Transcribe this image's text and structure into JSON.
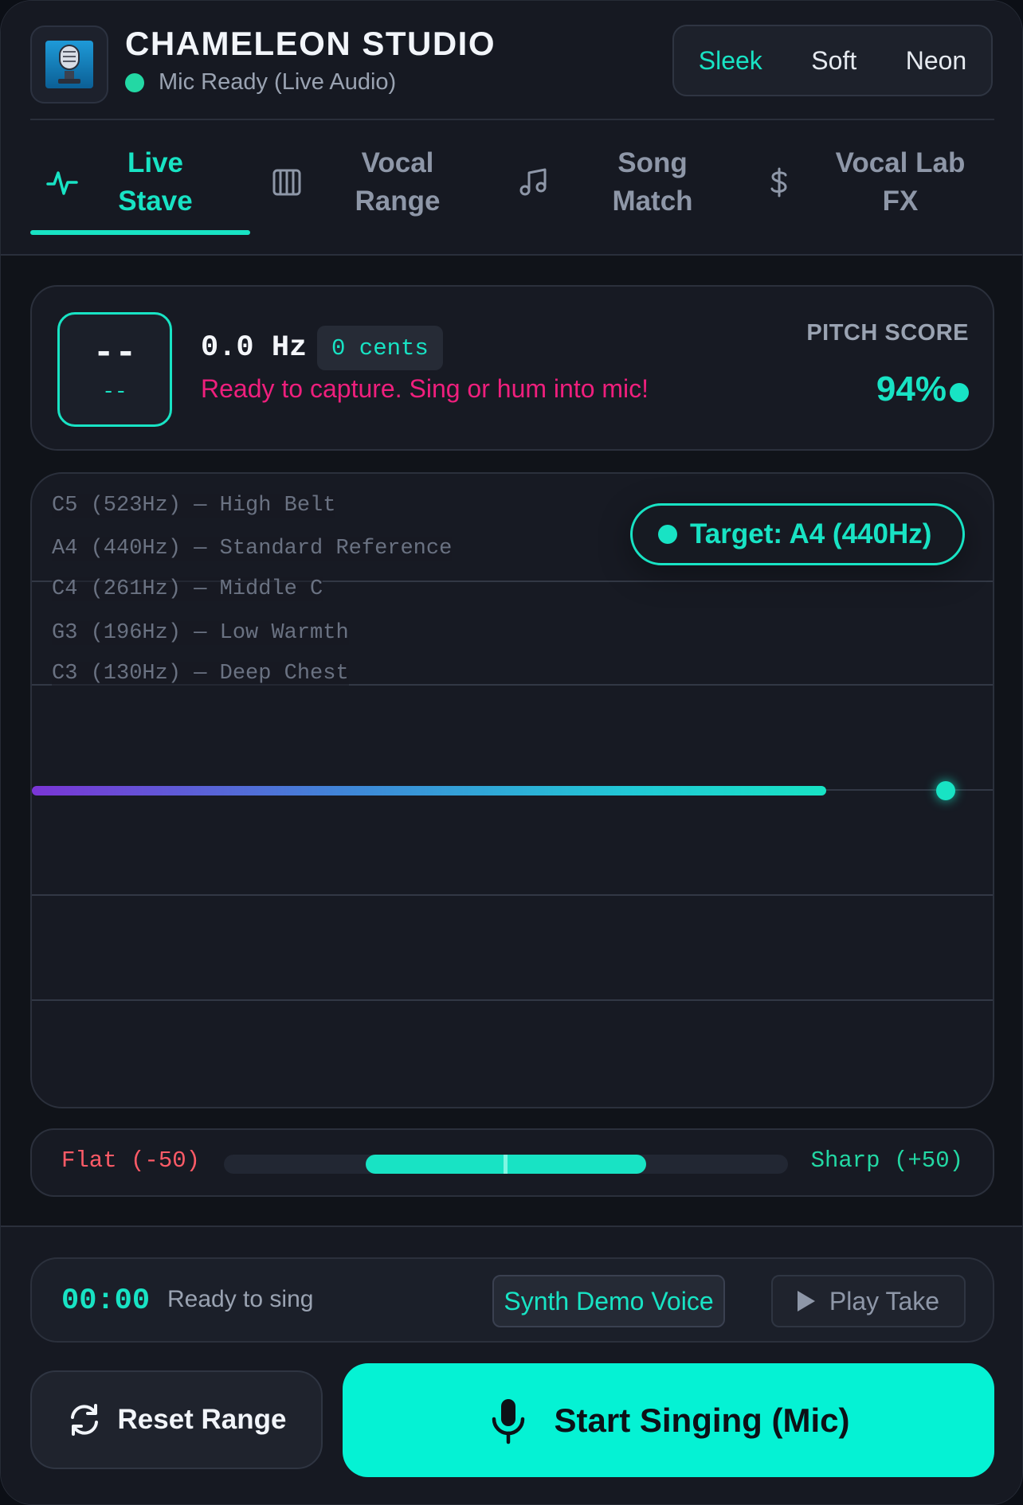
{
  "app": {
    "title": "CHAMELEON STUDIO",
    "status": "Mic Ready (Live Audio)",
    "status_color": "#23d8a4",
    "logo_icon": "microphone-icon"
  },
  "themes": {
    "options": [
      "Sleek",
      "Soft",
      "Neon"
    ],
    "active": "Sleek"
  },
  "tabs": [
    {
      "label_line1": "Live",
      "label_line2": "Stave",
      "icon": "pulse-icon",
      "active": true
    },
    {
      "label_line1": "Vocal",
      "label_line2": "Range",
      "icon": "piano-keys-icon",
      "active": false
    },
    {
      "label_line1": "Song",
      "label_line2": "Match",
      "icon": "music-note-icon",
      "active": false
    },
    {
      "label_line1": "Vocal Lab",
      "label_line2": "FX",
      "icon": "dollar-icon",
      "active": false
    }
  ],
  "pitch": {
    "note": "--",
    "octave": "--",
    "frequency": "0.0 Hz",
    "cents": "0 cents",
    "message": "Ready to capture. Sing or hum into mic!",
    "score_label": "PITCH SCORE",
    "score_value": "94%"
  },
  "stave": {
    "target": "Target: A4 (440Hz)",
    "notes": [
      "C5 (523Hz) — High Belt",
      "A4 (440Hz) — Standard Reference",
      "C4 (261Hz) — Middle C",
      "G3 (196Hz) — Low Warmth",
      "C3 (130Hz) — Deep Chest"
    ]
  },
  "tuning": {
    "flat_label": "Flat (-50)",
    "sharp_label": "Sharp (+50)",
    "range_min": -50,
    "range_max": 50,
    "band_low": -25,
    "band_high": 25
  },
  "transport": {
    "time": "00:00",
    "status": "Ready to sing",
    "synth_label": "Synth Demo Voice",
    "play_label": "Play Take"
  },
  "actions": {
    "reset_label": "Reset Range",
    "start_label": "Start Singing (Mic)"
  },
  "colors": {
    "accent": "#18e3c4",
    "warning": "#ef1f7d",
    "flat": "#ff5b67",
    "sharp": "#23d8a4",
    "cta": "#05f2d4"
  }
}
